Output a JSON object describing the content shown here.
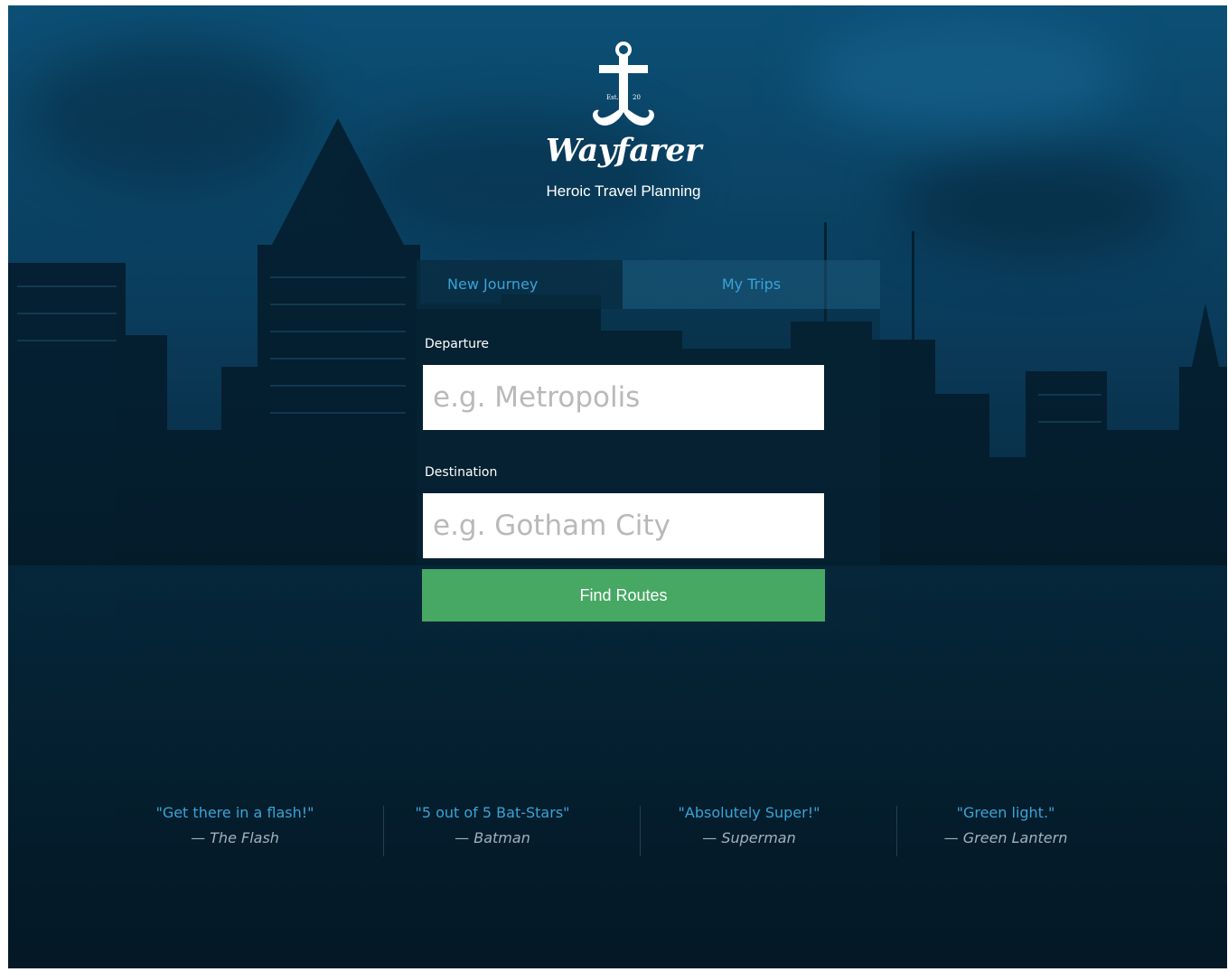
{
  "brand": {
    "name": "Wayfarer",
    "tagline": "Heroic Travel Planning",
    "logo_left": "Est.",
    "logo_right": "20",
    "logo_icon": "anchor-mustache-icon"
  },
  "tabs": [
    {
      "label": "New Journey",
      "active": true
    },
    {
      "label": "My Trips",
      "active": false
    }
  ],
  "form": {
    "departure_label": "Departure",
    "departure_placeholder": "e.g. Metropolis",
    "destination_label": "Destination",
    "destination_placeholder": "e.g. Gotham City",
    "submit_label": "Find Routes"
  },
  "testimonials": [
    {
      "quote": "\"Get there in a flash!\"",
      "author": "— The Flash"
    },
    {
      "quote": "\"5 out of 5 Bat-Stars\"",
      "author": "— Batman"
    },
    {
      "quote": "\"Absolutely Super!\"",
      "author": "— Superman"
    },
    {
      "quote": "\"Green light.\"",
      "author": "— Green Lantern"
    }
  ],
  "colors": {
    "accent": "#3aa3d6",
    "button": "#46a863",
    "background": "#0a3f60"
  }
}
